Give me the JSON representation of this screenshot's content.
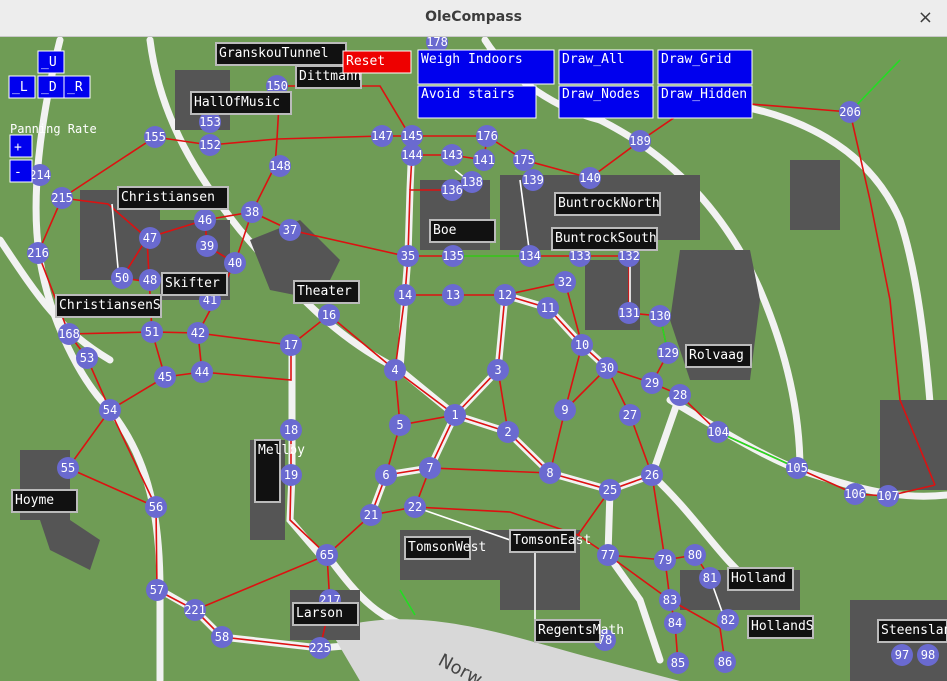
{
  "window": {
    "title": "OleCompass",
    "close_glyph": "×"
  },
  "colors": {
    "grass": "#6f9c55",
    "path": "#f2f2f2",
    "building": "#555555",
    "edge": "#dd1111",
    "green_edge": "#22dd22",
    "node": "#6a6ad0",
    "button": "#0000ee",
    "reset": "#ee0000",
    "label_box": "#111111"
  },
  "controls": {
    "pan_up": "_U",
    "pan_left": "_L",
    "pan_down": "_D",
    "pan_right": "_R",
    "panning_rate_label": "Panning Rate",
    "zoom_in": "+",
    "zoom_out": "-",
    "reset": "Reset",
    "weigh_indoors": "Weigh Indoors",
    "avoid_stairs": "Avoid stairs",
    "draw_all": "Draw_All",
    "draw_nodes": "Draw_Nodes",
    "draw_grid": "Draw_Grid",
    "draw_hidden": "Draw_Hidden"
  },
  "buildings": [
    "GranskouTunnel",
    "Dittmann",
    "HallOfMusic",
    "Christiansen",
    "Skifter",
    "ChristiansenS",
    "Theater",
    "Boe",
    "BuntrockNorth",
    "BuntrockSouth",
    "Rolvaag",
    "Mellby",
    "Hoyme",
    "TomsonWest",
    "TomsonEast",
    "Larson",
    "RegentsMath",
    "Holland",
    "HollandS",
    "Steensland"
  ],
  "road_label": "Norw",
  "nodes": [
    "1",
    "2",
    "3",
    "4",
    "5",
    "6",
    "7",
    "8",
    "9",
    "10",
    "11",
    "12",
    "13",
    "14",
    "16",
    "17",
    "18",
    "19",
    "21",
    "22",
    "25",
    "26",
    "27",
    "28",
    "29",
    "30",
    "32",
    "35",
    "37",
    "38",
    "39",
    "40",
    "41",
    "42",
    "44",
    "45",
    "46",
    "47",
    "48",
    "50",
    "51",
    "53",
    "54",
    "55",
    "56",
    "57",
    "58",
    "65",
    "77",
    "78",
    "79",
    "80",
    "81",
    "82",
    "83",
    "84",
    "85",
    "86",
    "97",
    "98",
    "104",
    "105",
    "106",
    "107",
    "129",
    "130",
    "131",
    "132",
    "133",
    "134",
    "135",
    "136",
    "138",
    "139",
    "140",
    "141",
    "143",
    "144",
    "145",
    "147",
    "148",
    "150",
    "152",
    "153",
    "155",
    "168",
    "175",
    "176",
    "178",
    "189",
    "206",
    "214",
    "215",
    "216",
    "217",
    "221",
    "225"
  ]
}
